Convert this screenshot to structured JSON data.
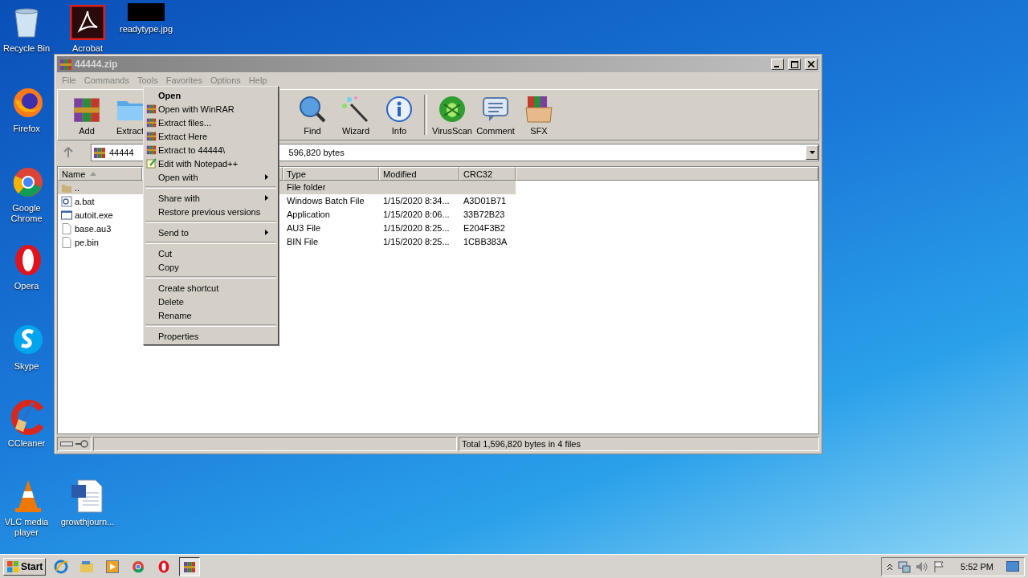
{
  "desktop_icons": [
    {
      "label": "Recycle Bin"
    },
    {
      "label": "Acrobat"
    },
    {
      "label": "readytype.jpg"
    },
    {
      "label": "Firefox"
    },
    {
      "label": "Google Chrome"
    },
    {
      "label": "Opera"
    },
    {
      "label": "Skype"
    },
    {
      "label": "CCleaner"
    },
    {
      "label": "VLC media player"
    },
    {
      "label": "growthjourn..."
    }
  ],
  "window": {
    "title": "44444.zip",
    "menu_bar": [
      "File",
      "Commands",
      "Tools",
      "Favorites",
      "Options",
      "Help"
    ],
    "toolbar": {
      "groups": [
        [
          {
            "label": "Add"
          },
          {
            "label": "Extract"
          }
        ],
        [
          {
            "label": "Find"
          },
          {
            "label": "Wizard"
          },
          {
            "label": "Info"
          }
        ],
        [
          {
            "label": "VirusScan"
          },
          {
            "label": "Comment"
          },
          {
            "label": "SFX"
          }
        ]
      ]
    },
    "address": {
      "name": "44444",
      "size": "596,820 bytes"
    },
    "columns": [
      "Name",
      "Type",
      "Modified",
      "CRC32"
    ],
    "rows": [
      {
        "kind": "folder",
        "name": "..",
        "type": "File folder",
        "selected": true
      },
      {
        "kind": "batch",
        "name": "a.bat",
        "type": "Windows Batch File",
        "modified": "1/15/2020 8:34...",
        "crc": "A3D01B71",
        "selected": false
      },
      {
        "kind": "exe",
        "name": "autoit.exe",
        "type": "Application",
        "modified": "1/15/2020 8:06...",
        "crc": "33B72B23",
        "selected": false
      },
      {
        "kind": "file",
        "name": "base.au3",
        "type": "AU3 File",
        "modified": "1/15/2020 8:25...",
        "crc": "E204F3B2",
        "selected": false
      },
      {
        "kind": "file",
        "name": "pe.bin",
        "type": "BIN File",
        "modified": "1/15/2020 8:25...",
        "crc": "1CBB383A",
        "selected": false
      }
    ],
    "status": "Total 1,596,820 bytes in 4 files"
  },
  "context_menu": [
    {
      "kind": "default",
      "label": "Open"
    },
    {
      "kind": "archive",
      "label": "Open with WinRAR"
    },
    {
      "kind": "archive",
      "label": "Extract files..."
    },
    {
      "kind": "archive",
      "label": "Extract Here"
    },
    {
      "kind": "archive",
      "label": "Extract to 44444\\"
    },
    {
      "kind": "notepad",
      "label": "Edit with Notepad++"
    },
    {
      "kind": "submenu",
      "label": "Open with"
    },
    {
      "kind": "separator"
    },
    {
      "kind": "submenu",
      "label": "Share with"
    },
    {
      "kind": "plain",
      "label": "Restore previous versions"
    },
    {
      "kind": "separator"
    },
    {
      "kind": "submenu",
      "label": "Send to"
    },
    {
      "kind": "separator"
    },
    {
      "kind": "plain",
      "label": "Cut"
    },
    {
      "kind": "plain",
      "label": "Copy"
    },
    {
      "kind": "separator"
    },
    {
      "kind": "plain",
      "label": "Create shortcut"
    },
    {
      "kind": "plain",
      "label": "Delete"
    },
    {
      "kind": "plain",
      "label": "Rename"
    },
    {
      "kind": "separator"
    },
    {
      "kind": "plain",
      "label": "Properties"
    }
  ],
  "taskbar": {
    "start": "Start",
    "clock": "5:52 PM"
  }
}
